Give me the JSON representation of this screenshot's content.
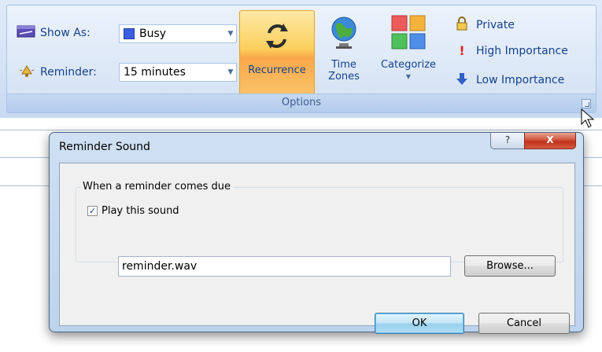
{
  "ribbon": {
    "show_as_label": "Show As:",
    "show_as_value": "Busy",
    "reminder_label": "Reminder:",
    "reminder_value": "15 minutes",
    "recurrence_label": "Recurrence",
    "time_zones_line1": "Time",
    "time_zones_line2": "Zones",
    "categorize_label": "Categorize",
    "private_label": "Private",
    "high_importance_label": "High Importance",
    "low_importance_label": "Low Importance",
    "group_label": "Options"
  },
  "dialog": {
    "title": "Reminder Sound",
    "help_glyph": "?",
    "close_glyph": "X",
    "group_title": "When a reminder comes due",
    "play_sound_label": "Play this sound",
    "play_sound_checked": true,
    "sound_file": "reminder.wav",
    "browse_label": "Browse...",
    "ok_label": "OK",
    "cancel_label": "Cancel"
  },
  "colors": {
    "accent": "#15428b",
    "busy": "#3c5fe0",
    "recurrence_highlight": "#fbcf5b",
    "close_button": "#c1311b"
  },
  "icons": {
    "show_as": "calendar-busy-icon",
    "reminder": "bell-icon",
    "recurrence": "recurrence-arrows-icon",
    "time_zones": "globe-icon",
    "categorize": "color-categories-icon",
    "private": "padlock-icon",
    "high_importance": "exclamation-icon",
    "low_importance": "down-arrow-icon"
  }
}
